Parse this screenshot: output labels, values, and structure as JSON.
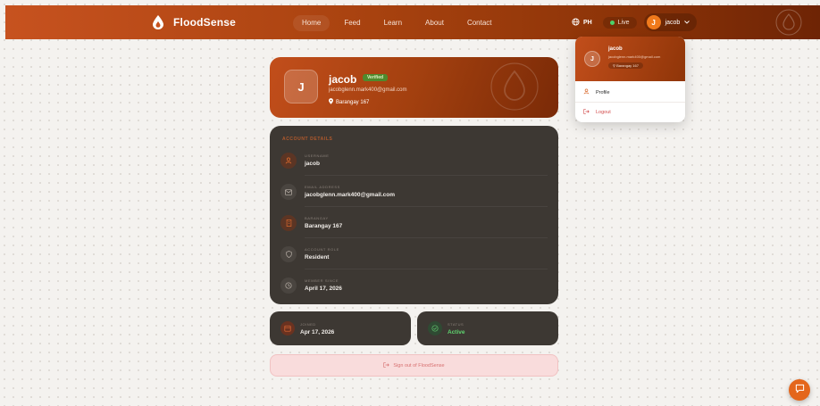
{
  "brand": {
    "name": "FloodSense",
    "accent": "#c7521f"
  },
  "nav": {
    "links": [
      "Home",
      "Feed",
      "Learn",
      "About",
      "Contact"
    ],
    "language": "PH",
    "live_label": "Live",
    "user_initial": "J",
    "user_name": "jacob"
  },
  "profile": {
    "initial": "J",
    "name": "jacob",
    "badge": "Verified",
    "email": "jacobglenn.mark400@gmail.com",
    "location": "Barangay 167"
  },
  "details": {
    "heading": "ACCOUNT DETAILS",
    "rows": [
      {
        "label": "USERNAME",
        "value": "jacob",
        "icon": "user-icon"
      },
      {
        "label": "EMAIL ADDRESS",
        "value": "jacobglenn.mark400@gmail.com",
        "icon": "mail-icon"
      },
      {
        "label": "BARANGAY",
        "value": "Barangay 167",
        "icon": "building-icon"
      },
      {
        "label": "ACCOUNT ROLE",
        "value": "Resident",
        "icon": "shield-icon"
      },
      {
        "label": "MEMBER SINCE",
        "value": "April 17, 2026",
        "icon": "clock-icon"
      }
    ]
  },
  "stats": {
    "joined": {
      "label": "JOINED",
      "value": "Apr 17, 2026"
    },
    "status": {
      "label": "STATUS",
      "value": "Active"
    }
  },
  "signout": {
    "label": "Sign out of FloodSense"
  },
  "dropdown": {
    "initial": "J",
    "name": "jacob",
    "email": "jacobglenn.mark400@gmail.com",
    "location": "Barangay 167",
    "profile_label": "Profile",
    "logout_label": "Logout"
  }
}
